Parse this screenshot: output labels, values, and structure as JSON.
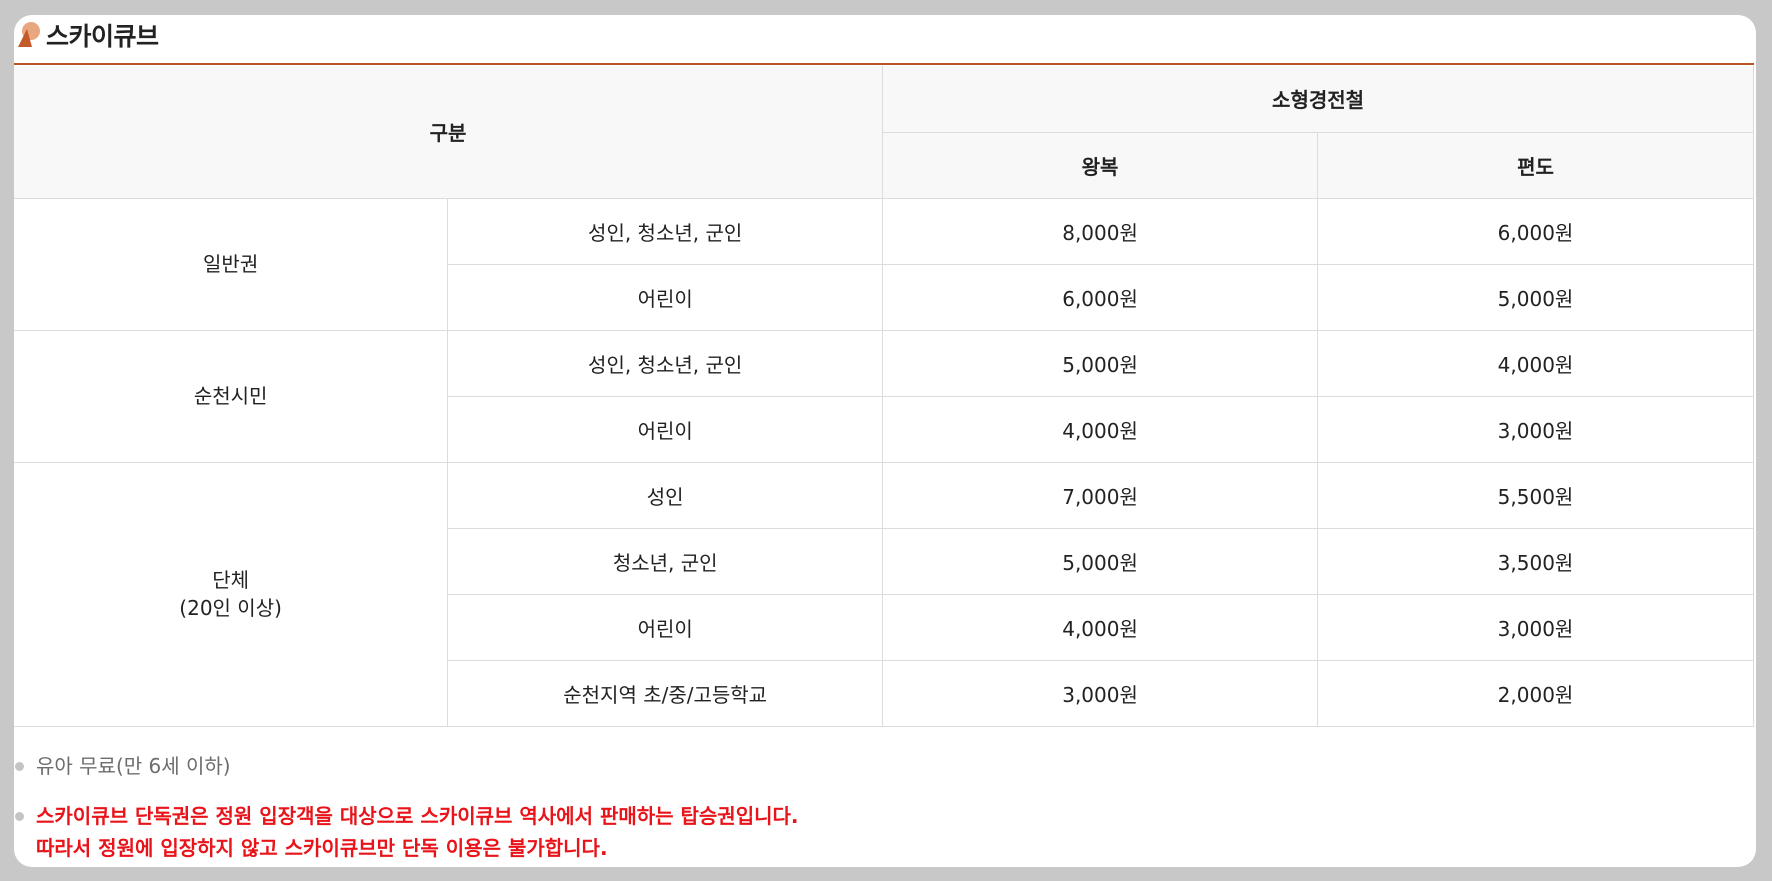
{
  "title": "스카이큐브",
  "colors": {
    "accent_line": "#b5532b",
    "notice_red": "#e8141a",
    "header_bg": "#f8f8f8"
  },
  "table": {
    "header": {
      "category": "구분",
      "vehicle": "소형경전철",
      "round_trip": "왕복",
      "one_way": "편도"
    },
    "groups": [
      {
        "name": "일반권",
        "rows": [
          {
            "type": "성인, 청소년, 군인",
            "round_trip": "8,000원",
            "one_way": "6,000원"
          },
          {
            "type": "어린이",
            "round_trip": "6,000원",
            "one_way": "5,000원"
          }
        ]
      },
      {
        "name": "순천시민",
        "rows": [
          {
            "type": "성인, 청소년, 군인",
            "round_trip": "5,000원",
            "one_way": "4,000원"
          },
          {
            "type": "어린이",
            "round_trip": "4,000원",
            "one_way": "3,000원"
          }
        ]
      },
      {
        "name_line1": "단체",
        "name_line2": "(20인 이상)",
        "rows": [
          {
            "type": "성인",
            "round_trip": "7,000원",
            "one_way": "5,500원"
          },
          {
            "type": "청소년, 군인",
            "round_trip": "5,000원",
            "one_way": "3,500원"
          },
          {
            "type": "어린이",
            "round_trip": "4,000원",
            "one_way": "3,000원"
          },
          {
            "type": "순천지역 초/중/고등학교",
            "round_trip": "3,000원",
            "one_way": "2,000원"
          }
        ]
      }
    ]
  },
  "notes": {
    "infant": "유아 무료(만 6세 이하)",
    "notice_line1": "스카이큐브 단독권은 정원 입장객을 대상으로 스카이큐브 역사에서 판매하는 탑승권입니다.",
    "notice_line2": "따라서 정원에 입장하지 않고 스카이큐브만 단독 이용은 불가합니다."
  }
}
